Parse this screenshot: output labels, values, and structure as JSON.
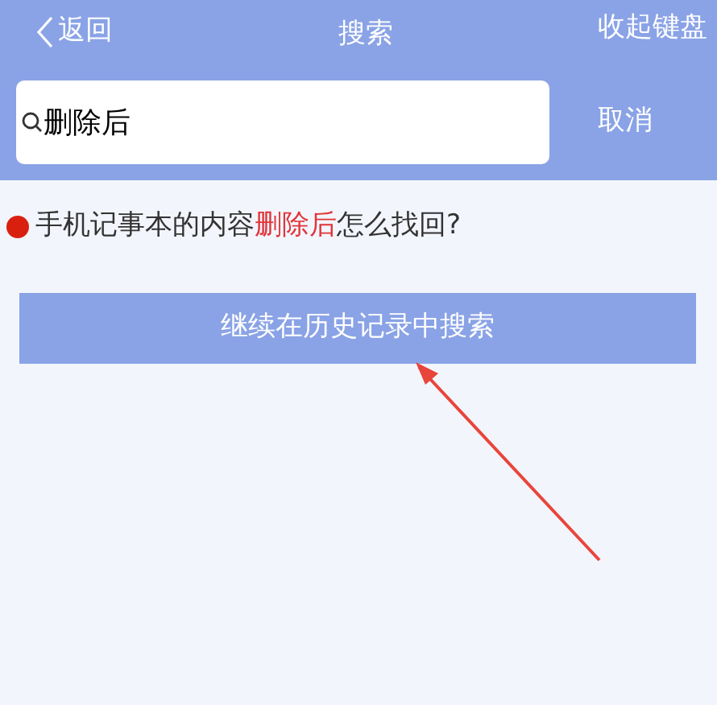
{
  "nav_bar": {
    "back": "返回",
    "title": "搜索",
    "right_action": "收起键盘"
  },
  "search": {
    "value": "删除后",
    "cancel": "取消"
  },
  "suggestions": [
    {
      "color": "#d9200f",
      "parts": [
        {
          "text": "手机记事本的内容",
          "highlight": false
        },
        {
          "text": "删除后",
          "highlight": true
        },
        {
          "text": "怎么找回?",
          "highlight": false
        }
      ]
    }
  ],
  "history_button": "继续在历史记录中搜索"
}
